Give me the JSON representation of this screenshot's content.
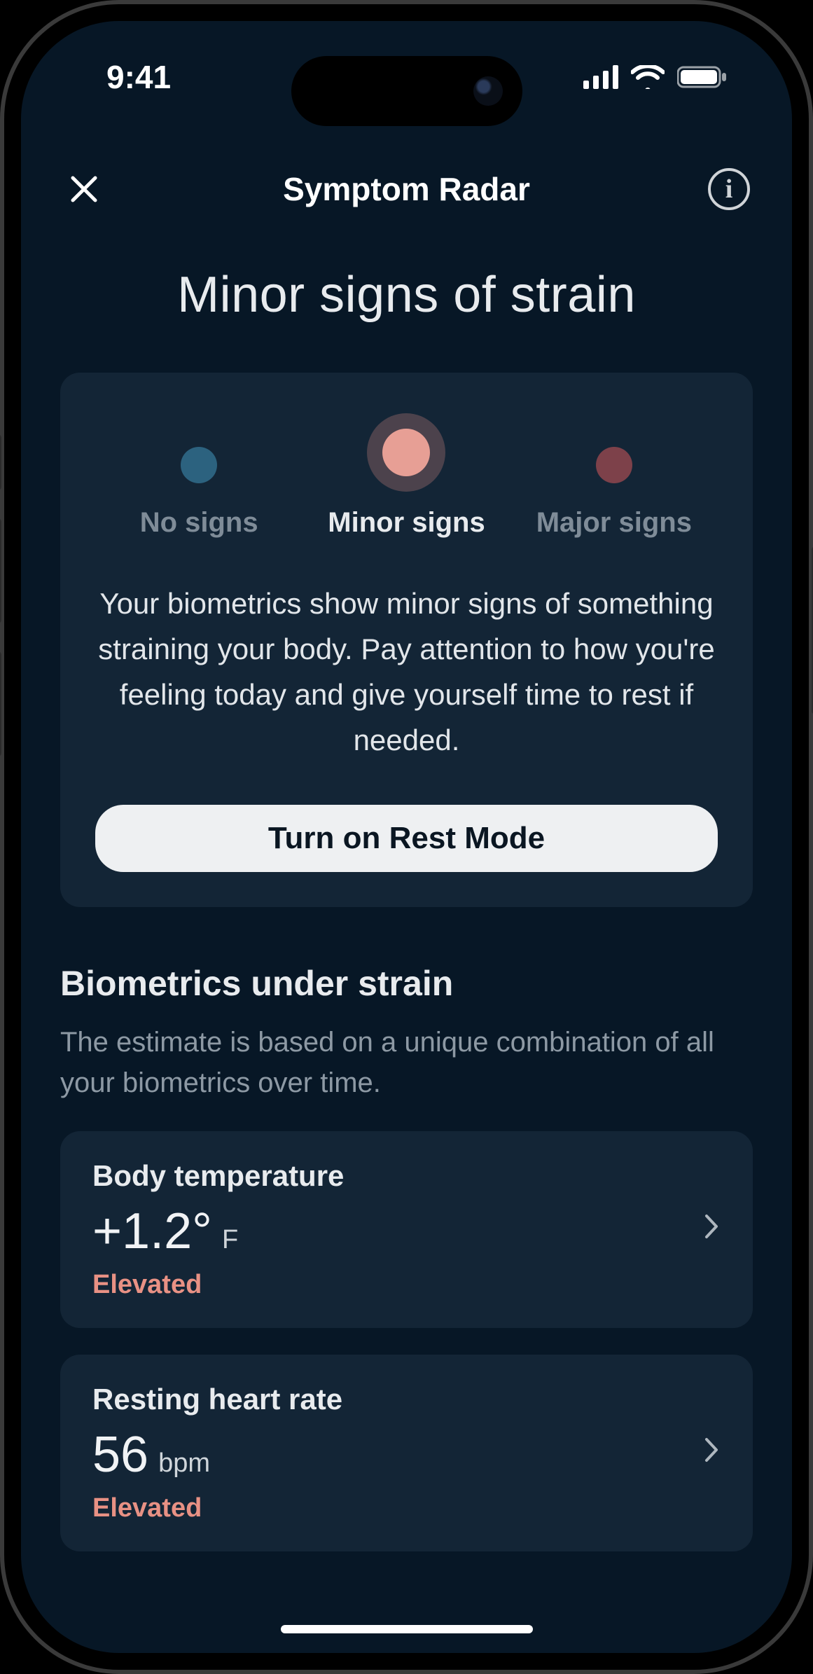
{
  "status": {
    "time": "9:41"
  },
  "nav": {
    "title": "Symptom Radar"
  },
  "page_title": "Minor signs of strain",
  "card": {
    "legend": [
      {
        "label": "No signs",
        "color": "#2c627f",
        "active": false
      },
      {
        "label": "Minor signs",
        "color": "#e79f95",
        "active": true
      },
      {
        "label": "Major signs",
        "color": "#7d414a",
        "active": false
      }
    ],
    "description": "Your biometrics show minor signs of something straining your body. Pay attention to how you're feeling today and give yourself time to rest if needed.",
    "button": "Turn on Rest Mode"
  },
  "section": {
    "title": "Biometrics under strain",
    "subtitle": "The estimate is based on a unique combination of all your biometrics over time."
  },
  "metrics": [
    {
      "name": "Body temperature",
      "value": "+1.2°",
      "unit": "F",
      "status": "Elevated"
    },
    {
      "name": "Resting heart rate",
      "value": "56",
      "unit": "bpm",
      "status": "Elevated"
    }
  ],
  "colors": {
    "bg": "#071726",
    "card": "#132536",
    "accent": "#e89184"
  }
}
